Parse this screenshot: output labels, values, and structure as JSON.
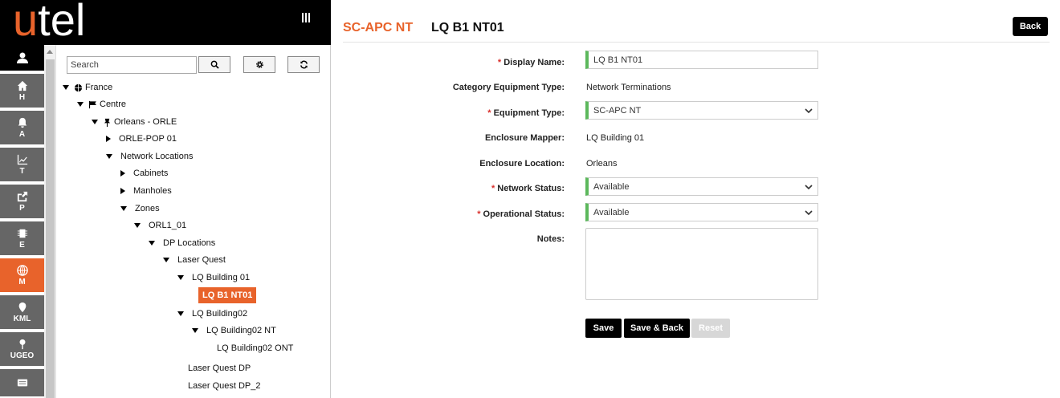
{
  "brand": {
    "logo_accent": "u",
    "logo_rest": "tel"
  },
  "colors": {
    "accent": "#e8632b",
    "valid": "#5cb85c",
    "required": "#d9302c"
  },
  "sidebar": {
    "items": [
      {
        "key": "user",
        "icon": "user-icon",
        "label": ""
      },
      {
        "key": "home",
        "icon": "home-icon",
        "label": "H"
      },
      {
        "key": "alerts",
        "icon": "bell-icon",
        "label": "A"
      },
      {
        "key": "trends",
        "icon": "chart-icon",
        "label": "T"
      },
      {
        "key": "publish",
        "icon": "share-icon",
        "label": "P"
      },
      {
        "key": "equipment",
        "icon": "chip-icon",
        "label": "E"
      },
      {
        "key": "map",
        "icon": "globe-icon",
        "label": "M"
      },
      {
        "key": "kml",
        "icon": "map-pin-icon",
        "label": "KML"
      },
      {
        "key": "ugeo",
        "icon": "pushpin-icon",
        "label": "UGEO"
      },
      {
        "key": "more",
        "icon": "card-icon",
        "label": ""
      }
    ]
  },
  "tree": {
    "search_placeholder": "Search",
    "nodes": [
      {
        "label": "France",
        "state": "expanded",
        "icon": "globe-icon"
      },
      {
        "label": "Centre",
        "state": "expanded",
        "icon": "flag-icon"
      },
      {
        "label": "Orleans - ORLE",
        "state": "expanded",
        "icon": "pin-icon"
      },
      {
        "label": "ORLE-POP 01",
        "state": "collapsed"
      },
      {
        "label": "Network Locations",
        "state": "expanded"
      },
      {
        "label": "Cabinets",
        "state": "collapsed"
      },
      {
        "label": "Manholes",
        "state": "collapsed"
      },
      {
        "label": "Zones",
        "state": "expanded"
      },
      {
        "label": "ORL1_01",
        "state": "expanded"
      },
      {
        "label": "DP Locations",
        "state": "expanded"
      },
      {
        "label": "Laser Quest",
        "state": "expanded"
      },
      {
        "label": "LQ Building 01",
        "state": "expanded"
      },
      {
        "label": "LQ B1 NT01",
        "state": "selected"
      },
      {
        "label": "LQ Building02",
        "state": "expanded"
      },
      {
        "label": "LQ Building02 NT",
        "state": "expanded"
      },
      {
        "label": "LQ Building02 ONT",
        "state": "leaf"
      },
      {
        "label": "Laser Quest DP",
        "state": "leaf"
      },
      {
        "label": "Laser Quest DP_2",
        "state": "leaf"
      }
    ]
  },
  "header": {
    "type_title": "SC-APC NT",
    "name_title": "LQ B1 NT01",
    "back_label": "Back"
  },
  "form": {
    "display_name": {
      "label": "Display Name:",
      "value": "LQ B1 NT01"
    },
    "category": {
      "label": "Category Equipment Type:",
      "value": "Network Terminations"
    },
    "equipment_type": {
      "label": "Equipment Type:",
      "value": "SC-APC NT"
    },
    "enclosure_mapper": {
      "label": "Enclosure Mapper:",
      "value": "LQ Building 01"
    },
    "enclosure_location": {
      "label": "Enclosure Location:",
      "value": "Orleans"
    },
    "network_status": {
      "label": "Network Status:",
      "value": "Available"
    },
    "operational_status": {
      "label": "Operational Status:",
      "value": "Available"
    },
    "notes": {
      "label": "Notes:",
      "value": ""
    },
    "required_mark": "*"
  },
  "actions": {
    "save": "Save",
    "save_back": "Save & Back",
    "reset": "Reset"
  }
}
